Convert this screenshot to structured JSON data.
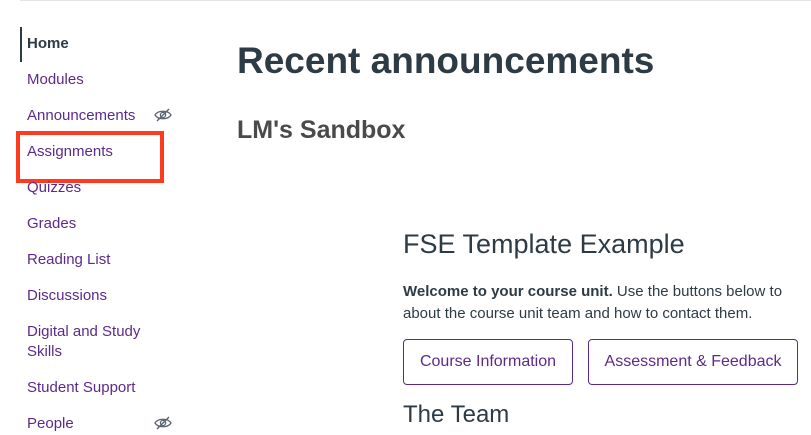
{
  "sidebar": {
    "items": [
      {
        "label": "Home",
        "active": true
      },
      {
        "label": "Modules"
      },
      {
        "label": "Announcements",
        "hidden_icon": "eye-slash-icon"
      },
      {
        "label": "Assignments",
        "highlighted": true
      },
      {
        "label": "Quizzes"
      },
      {
        "label": "Grades"
      },
      {
        "label": "Reading List"
      },
      {
        "label": "Discussions"
      },
      {
        "label": "Digital and Study",
        "label_line2": "Skills"
      },
      {
        "label": "Student Support"
      },
      {
        "label": "People",
        "hidden_icon": "eye-slash-icon"
      }
    ]
  },
  "main": {
    "page_title": "Recent announcements",
    "course_title": "LM's Sandbox",
    "template_title": "FSE Template Example",
    "welcome_bold": "Welcome to your course unit.",
    "welcome_rest": " Use the buttons below to",
    "welcome_line2": "about the course unit team and how to contact them.",
    "buttons": {
      "course_information": "Course Information",
      "assessment_feedback": "Assessment & Feedback"
    },
    "team_title": "The Team"
  },
  "colors": {
    "link_purple": "#5d2a8a",
    "text_dark": "#2d3b45",
    "highlight_red": "#ff3b1f"
  }
}
